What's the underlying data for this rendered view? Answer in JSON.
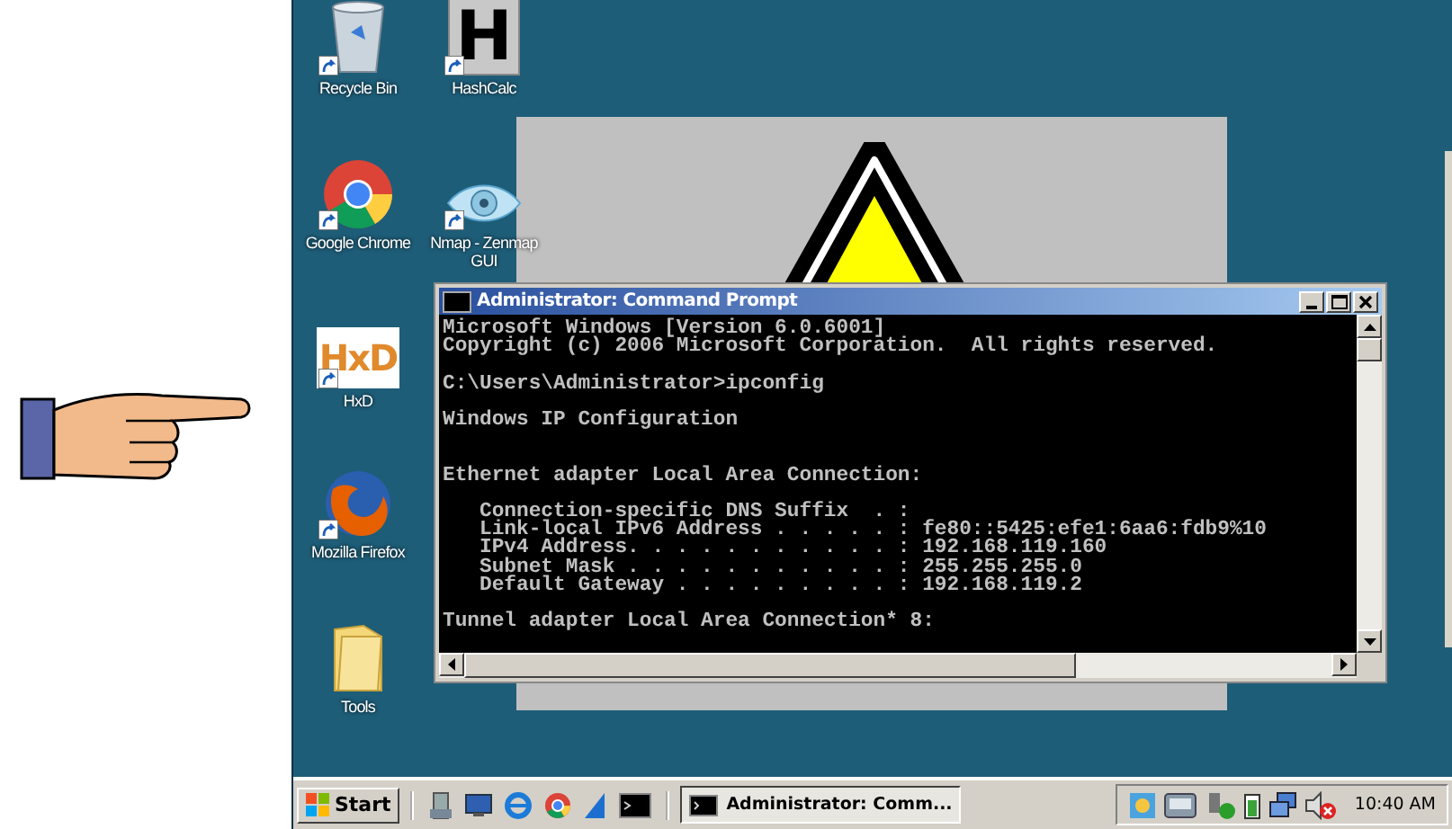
{
  "desktop_icon_columns": [
    [
      {
        "kind": "recycle-bin",
        "label": "Recycle Bin"
      },
      {
        "kind": "chrome",
        "label": "Google Chrome"
      },
      {
        "kind": "hxd",
        "label": "HxD",
        "glyph": "HxD"
      },
      {
        "kind": "firefox",
        "label": "Mozilla Firefox"
      },
      {
        "kind": "folder",
        "label": "Tools"
      }
    ],
    [
      {
        "kind": "letter-tile",
        "label": "HashCalc",
        "glyph": "H"
      },
      {
        "kind": "eye",
        "label": "Nmap - Zenmap GUI"
      }
    ]
  ],
  "console_window": {
    "title": "Administrator: Command Prompt",
    "blocks": [
      [
        "Microsoft Windows [Version 6.0.6001]",
        "Copyright (c) 2006 Microsoft Corporation.  All rights reserved."
      ],
      [
        "C:\\Users\\Administrator>ipconfig"
      ],
      [
        "Windows IP Configuration"
      ],
      [
        "Ethernet adapter Local Area Connection:"
      ],
      [
        "   Connection-specific DNS Suffix  . :",
        "   Link-local IPv6 Address . . . . . : fe80::5425:efe1:6aa6:fdb9%10",
        "   IPv4 Address. . . . . . . . . . . : 192.168.119.160",
        "   Subnet Mask . . . . . . . . . . . : 255.255.255.0",
        "   Default Gateway . . . . . . . . . : 192.168.119.2"
      ],
      [
        "Tunnel adapter Local Area Connection* 8:"
      ]
    ]
  },
  "taskbar": {
    "start": "Start",
    "task_button": "Administrator: Comm...",
    "clock": "10:40 AM"
  }
}
